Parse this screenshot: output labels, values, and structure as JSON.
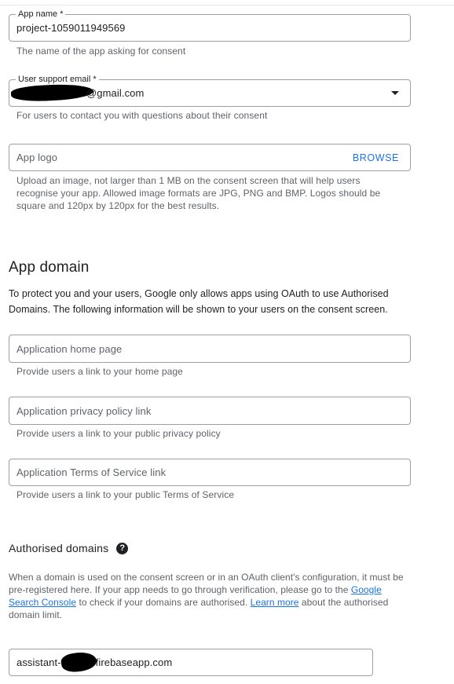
{
  "app_info": {
    "app_name_label": "App name *",
    "app_name_value": "project-1059011949569",
    "app_name_helper": "The name of the app asking for consent",
    "support_email_label": "User support email *",
    "support_email_value": "@gmail.com",
    "support_email_helper": "For users to contact you with questions about their consent",
    "logo_placeholder": "App logo",
    "logo_browse": "BROWSE",
    "logo_helper": "Upload an image, not larger than 1 MB on the consent screen that will help users recognise your app. Allowed image formats are JPG, PNG and BMP. Logos should be square and 120px by 120px for the best results."
  },
  "app_domain": {
    "title": "App domain",
    "description": "To protect you and your users, Google only allows apps using OAuth to use Authorised Domains. The following information will be shown to your users on the consent screen.",
    "home_page_placeholder": "Application home page",
    "home_page_helper": "Provide users a link to your home page",
    "privacy_placeholder": "Application privacy policy link",
    "privacy_helper": "Provide users a link to your public privacy policy",
    "tos_placeholder": "Application Terms of Service link",
    "tos_helper": "Provide users a link to your public Terms of Service"
  },
  "authorised_domains": {
    "title": "Authorised domains",
    "help_icon": "?",
    "desc_part1": "When a domain is used on the consent screen or in an OAuth client's configuration, it must be pre-registered here. If your app needs to go through verification, please go to the ",
    "link_search_console": "Google Search Console",
    "desc_part2": " to check if your domains are authorised. ",
    "link_learn_more": "Learn more",
    "desc_part3": " about the authorised domain limit.",
    "domain_prefix": "assistant-",
    "domain_suffix": "firebaseapp.com"
  },
  "colors": {
    "accent": "#1a73e8",
    "border": "#9aa0a6",
    "text": "#202124",
    "helper": "#5f6368"
  },
  "icons": {
    "dropdown": "chevron-down-icon",
    "help": "help-circle-icon"
  }
}
